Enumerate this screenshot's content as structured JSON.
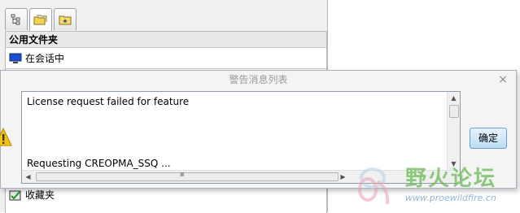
{
  "navigator": {
    "tabs": [
      {
        "icon": "tree-icon"
      },
      {
        "icon": "folder-browser-icon"
      },
      {
        "icon": "favorites-icon"
      }
    ],
    "section_title": "公用文件夹",
    "items": [
      {
        "label": "在会话中",
        "icon": "monitor-icon"
      },
      {
        "label": "收藏夹",
        "icon": "favorites-folder-icon"
      }
    ]
  },
  "dialog": {
    "title": "警告消息列表",
    "close_symbol": "×",
    "messages": [
      "License request failed for feature",
      "Requesting CREOPMA_SSQ ..."
    ],
    "ok_label": "确定",
    "scroll_grip": "IIII"
  },
  "watermark": {
    "brand": "野火论坛",
    "url": "www.proewildfire.cn"
  },
  "colors": {
    "warning": "#f5c400",
    "ok_border": "#6d9ed1",
    "watermark_green": "#7cc06b"
  }
}
